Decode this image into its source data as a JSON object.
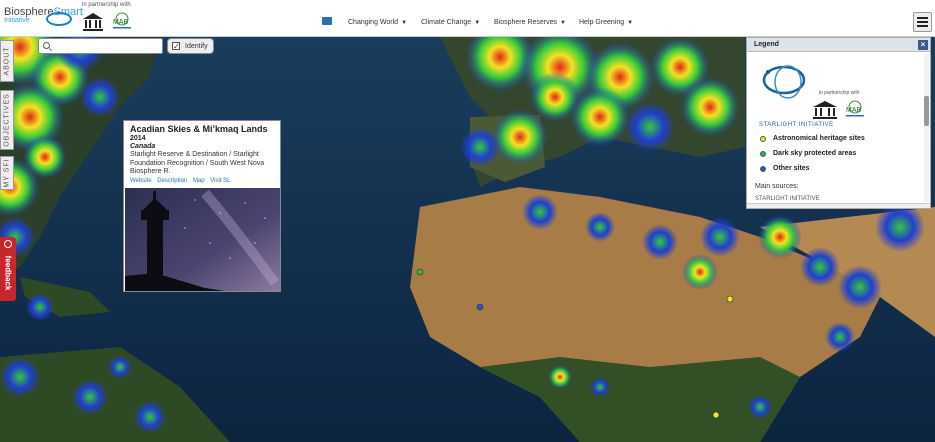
{
  "header": {
    "brand_main": "Biosphere",
    "brand_accent": "Smart",
    "brand_sub": "Initiative",
    "partner_text": "in partnership with",
    "nav": [
      {
        "label": "Changing World"
      },
      {
        "label": "Climate Change"
      },
      {
        "label": "Biosphere Reserves"
      },
      {
        "label": "Help Greening"
      }
    ]
  },
  "sidetabs": {
    "about": "ABOUT",
    "objectives": "OBJECTIVES",
    "mysl": "MY SFI",
    "feedback": "feedback"
  },
  "search": {
    "placeholder": "",
    "value": "",
    "identify_label": "Identify",
    "identify_checked": "✓"
  },
  "popup": {
    "title": "Acadian Skies & Mi’kmaq Lands",
    "year": "2014",
    "country": "Canada",
    "description": "Starlight Reserve & Destination / Starlight Foundation Recognition / South West Nova Biosphere R.",
    "links": [
      "Website",
      "Description",
      "Map",
      "Visit SL"
    ]
  },
  "legend": {
    "title": "Legend",
    "close": "×",
    "partner_text": "in partnership with",
    "logo_label": "STARLIGHT INITIATIVE",
    "items": [
      {
        "label": "Astronomical heritage sites",
        "color": "#e8e82a"
      },
      {
        "label": "Dark sky protected areas",
        "color": "#2fb34a"
      },
      {
        "label": "Other sites",
        "color": "#2b4fc9"
      }
    ],
    "sources_label": "Main sources:",
    "sources_first": "STARLIGHT INITIATIVE"
  },
  "colors": {
    "ocean": "#123150",
    "land": "#2f4a2b",
    "desert": "#b6874d",
    "light_low": "#1f3fd0",
    "light_mid": "#34c93c",
    "light_high": "#f2e321",
    "light_peak": "#e32519"
  }
}
